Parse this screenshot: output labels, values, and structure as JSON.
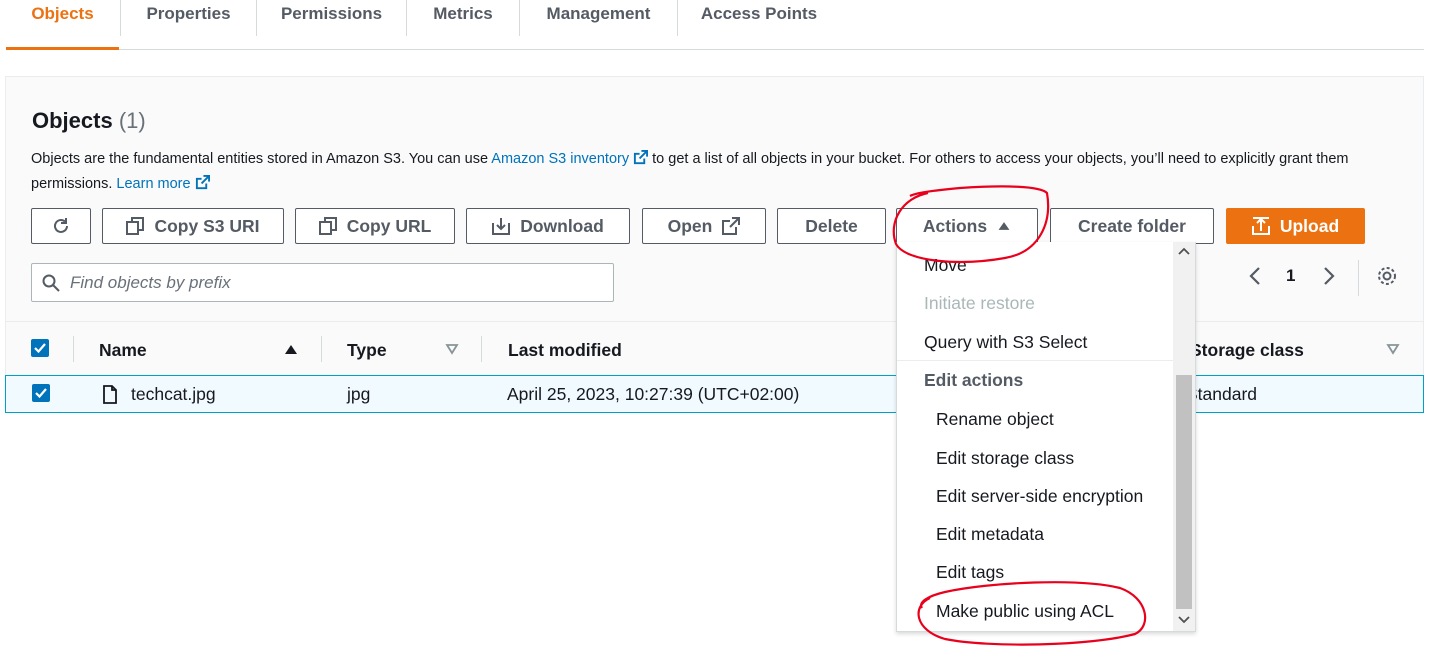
{
  "tabs": [
    {
      "label": "Objects",
      "active": true
    },
    {
      "label": "Properties"
    },
    {
      "label": "Permissions"
    },
    {
      "label": "Metrics"
    },
    {
      "label": "Management"
    },
    {
      "label": "Access Points"
    }
  ],
  "objects": {
    "title": "Objects",
    "count": "(1)",
    "desc_part1": "Objects are the fundamental entities stored in Amazon S3. You can use",
    "inventory_link": "Amazon S3 inventory",
    "desc_part2": "to get a list of all objects in your bucket. For others to access your objects, you’ll need to explicitly grant them permissions.",
    "learn_more": "Learn more"
  },
  "toolbar": {
    "copy_s3_uri": "Copy S3 URI",
    "copy_url": "Copy URL",
    "download": "Download",
    "open": "Open",
    "delete": "Delete",
    "actions": "Actions",
    "create_folder": "Create folder",
    "upload": "Upload"
  },
  "search": {
    "placeholder": "Find objects by prefix"
  },
  "pagination": {
    "page": "1"
  },
  "table": {
    "headers": {
      "name": "Name",
      "type": "Type",
      "last_modified": "Last modified",
      "storage_class": "Storage class"
    },
    "rows": [
      {
        "name": "techcat.jpg",
        "type": "jpg",
        "last_modified": "April 25, 2023, 10:27:39 (UTC+02:00)",
        "storage_class": "Standard",
        "selected": true
      }
    ]
  },
  "actions_menu": {
    "move": "Move",
    "initiate_restore": "Initiate restore",
    "query": "Query with S3 Select",
    "edit_group": "Edit actions",
    "rename": "Rename object",
    "edit_storage": "Edit storage class",
    "edit_encryption": "Edit server-side encryption",
    "edit_metadata": "Edit metadata",
    "edit_tags": "Edit tags",
    "make_public": "Make public using ACL"
  },
  "colors": {
    "accent": "#ec7211",
    "link": "#0073bb",
    "annotation": "#e8001c"
  }
}
